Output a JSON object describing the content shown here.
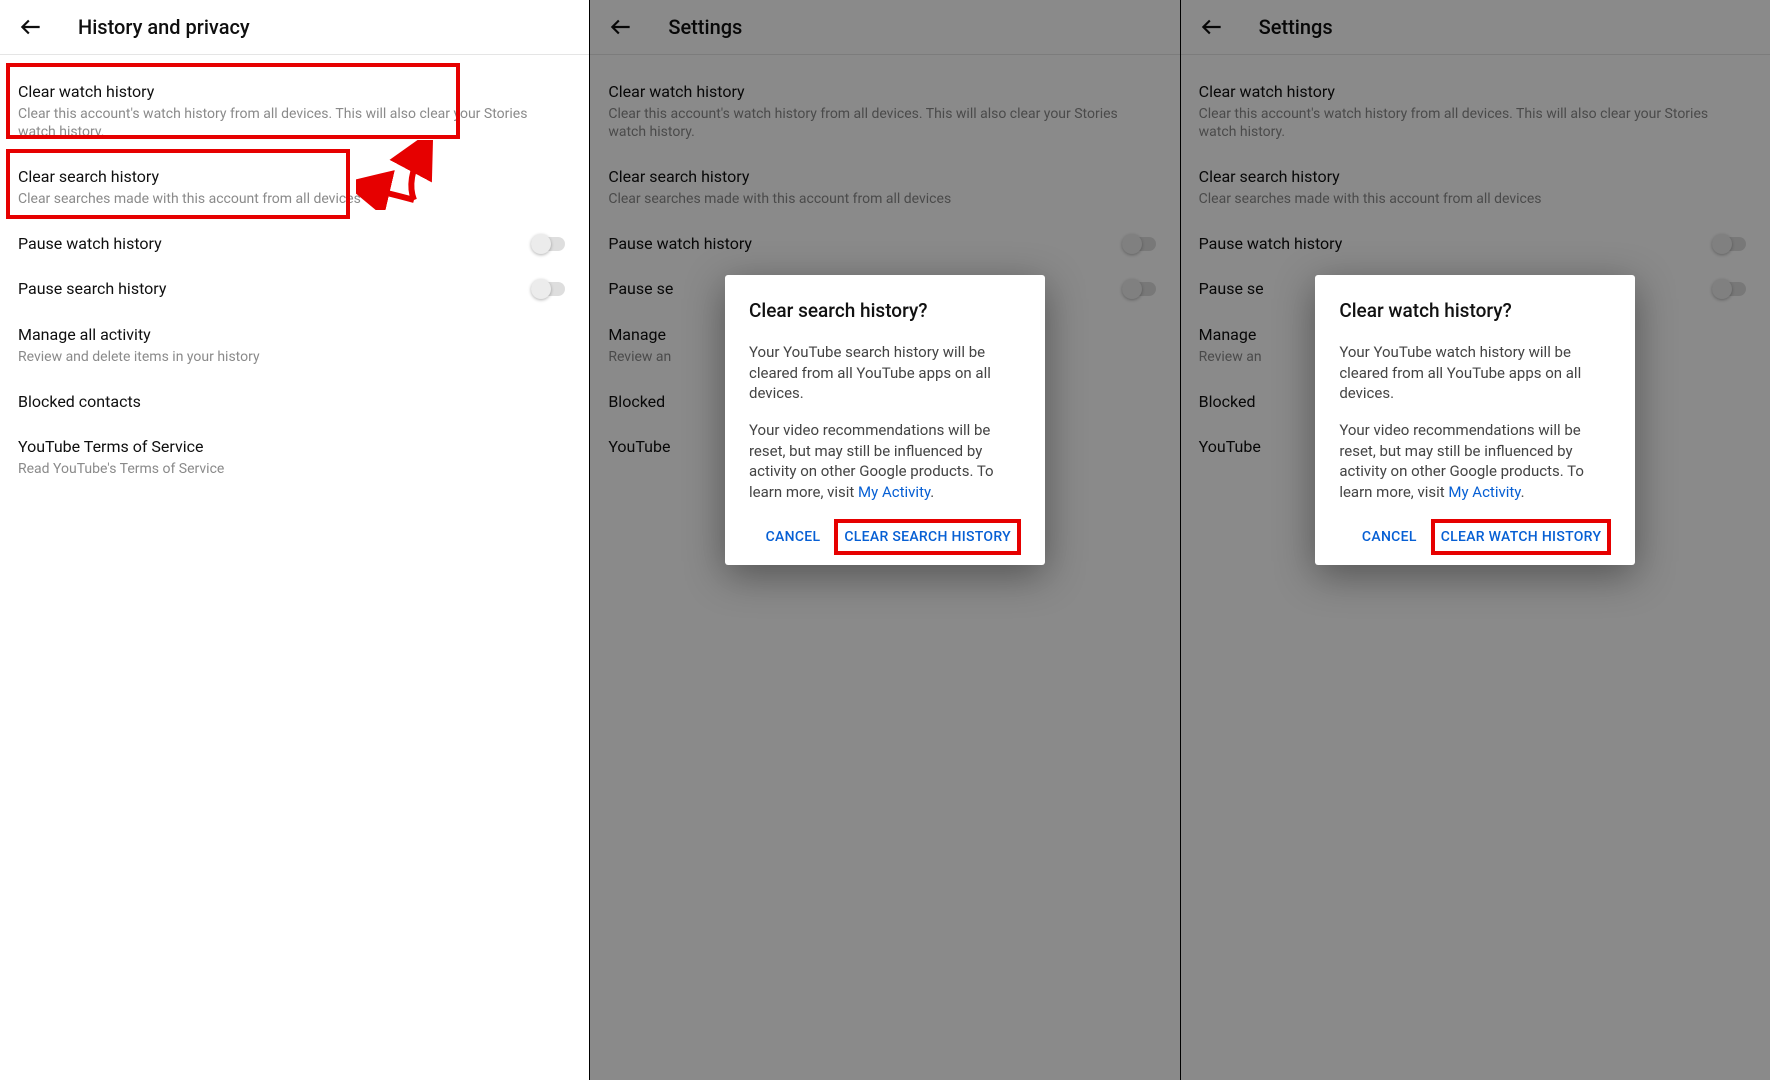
{
  "panel1": {
    "header_title": "History and privacy",
    "items": {
      "clear_watch": {
        "title": "Clear watch history",
        "sub": "Clear this account's watch history from all devices. This will also clear your Stories watch history."
      },
      "clear_search": {
        "title": "Clear search history",
        "sub": "Clear searches made with this account from all devices"
      },
      "pause_watch": {
        "title": "Pause watch history"
      },
      "pause_search": {
        "title": "Pause search history"
      },
      "manage": {
        "title": "Manage all activity",
        "sub": "Review and delete items in your history"
      },
      "blocked": {
        "title": "Blocked contacts"
      },
      "tos": {
        "title": "YouTube Terms of Service",
        "sub": "Read YouTube's Terms of Service"
      }
    }
  },
  "panel_bg": {
    "header_title": "Settings",
    "items": {
      "clear_watch": {
        "title": "Clear watch history",
        "sub": "Clear this account's watch history from all devices. This will also clear your Stories watch history."
      },
      "clear_search": {
        "title": "Clear search history",
        "sub": "Clear searches made with this account from all devices"
      },
      "pause_watch": {
        "title": "Pause watch history"
      },
      "pause_search_trunc": {
        "title": "Pause se"
      },
      "manage_trunc": {
        "title": "Manage",
        "sub": "Review an"
      },
      "blocked_trunc": {
        "title": "Blocked"
      },
      "tos_trunc": {
        "title": "YouTube"
      }
    }
  },
  "dialog_search": {
    "title": "Clear search history?",
    "body1": "Your YouTube search history will be cleared from all YouTube apps on all devices.",
    "body2a": "Your video recommendations will be reset, but may still be influenced by activity on other Google products. To learn more, visit ",
    "link": "My Activity",
    "body2b": ".",
    "cancel": "CANCEL",
    "confirm": "CLEAR SEARCH HISTORY"
  },
  "dialog_watch": {
    "title": "Clear watch history?",
    "body1": "Your YouTube watch history will be cleared from all YouTube apps on all devices.",
    "body2a": "Your video recommendations will be reset, but may still be influenced by activity on other Google products. To learn more, visit ",
    "link": "My Activity",
    "body2b": ".",
    "cancel": "CANCEL",
    "confirm": "CLEAR WATCH HISTORY"
  }
}
